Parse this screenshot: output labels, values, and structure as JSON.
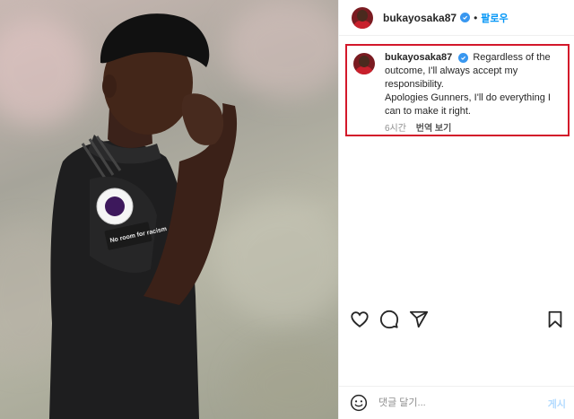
{
  "post": {
    "username": "bukayosaka87",
    "follow_label": "팔로우",
    "separator": "•"
  },
  "caption": {
    "username": "bukayosaka87",
    "lines": [
      "Regardless of the",
      "outcome, I'll always accept my",
      "responsibility.",
      "Apologies Gunners, I'll do everything I",
      "can to make it right."
    ],
    "time": "6시간",
    "translate_label": "번역 보기",
    "highlight_color": "#d3182a"
  },
  "actions": {
    "like_icon": "heart-icon",
    "comment_icon": "comment-icon",
    "share_icon": "share-icon",
    "save_icon": "bookmark-icon"
  },
  "comment": {
    "placeholder": "댓글 달기...",
    "post_label": "게시"
  },
  "photo": {
    "sleeve_patch": "No room for racism"
  }
}
